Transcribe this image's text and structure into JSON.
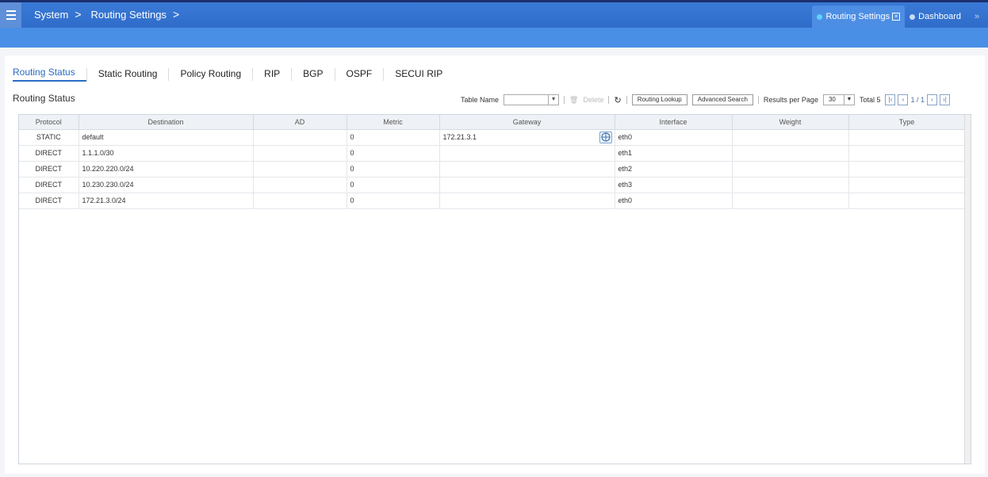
{
  "header": {
    "breadcrumb": [
      "System",
      "Routing Settings"
    ],
    "window_tabs": [
      {
        "label": "Routing Settings",
        "dot_color": "#5fd4ff",
        "active": true
      },
      {
        "label": "Dashboard",
        "dot_color": "#c9dcf7",
        "active": false
      }
    ],
    "more_label": "»"
  },
  "nav": {
    "tabs": [
      "Routing Status",
      "Static Routing",
      "Policy Routing",
      "RIP",
      "BGP",
      "OSPF",
      "SECUI RIP"
    ]
  },
  "section_title": "Routing Status",
  "toolbar": {
    "table_name_label": "Table Name",
    "table_name_value": "",
    "delete_label": "Delete",
    "routing_lookup_label": "Routing Lookup",
    "advanced_search_label": "Advanced Search",
    "results_per_page_label": "Results per Page",
    "results_per_page_value": "30",
    "total_label": "Total 5",
    "page_label": "1 / 1"
  },
  "table": {
    "columns": [
      "Protocol",
      "Destination",
      "AD",
      "Metric",
      "Gateway",
      "Interface",
      "Weight",
      "Type"
    ],
    "rows": [
      [
        "STATIC",
        "default",
        "",
        "0",
        "172.21.3.1",
        "eth0",
        "",
        ""
      ],
      [
        "DIRECT",
        "1.1.1.0/30",
        "",
        "0",
        "",
        "eth1",
        "",
        ""
      ],
      [
        "DIRECT",
        "10.220.220.0/24",
        "",
        "0",
        "",
        "eth2",
        "",
        ""
      ],
      [
        "DIRECT",
        "10.230.230.0/24",
        "",
        "0",
        "",
        "eth3",
        "",
        ""
      ],
      [
        "DIRECT",
        "172.21.3.0/24",
        "",
        "0",
        "",
        "eth0",
        "",
        ""
      ]
    ]
  }
}
